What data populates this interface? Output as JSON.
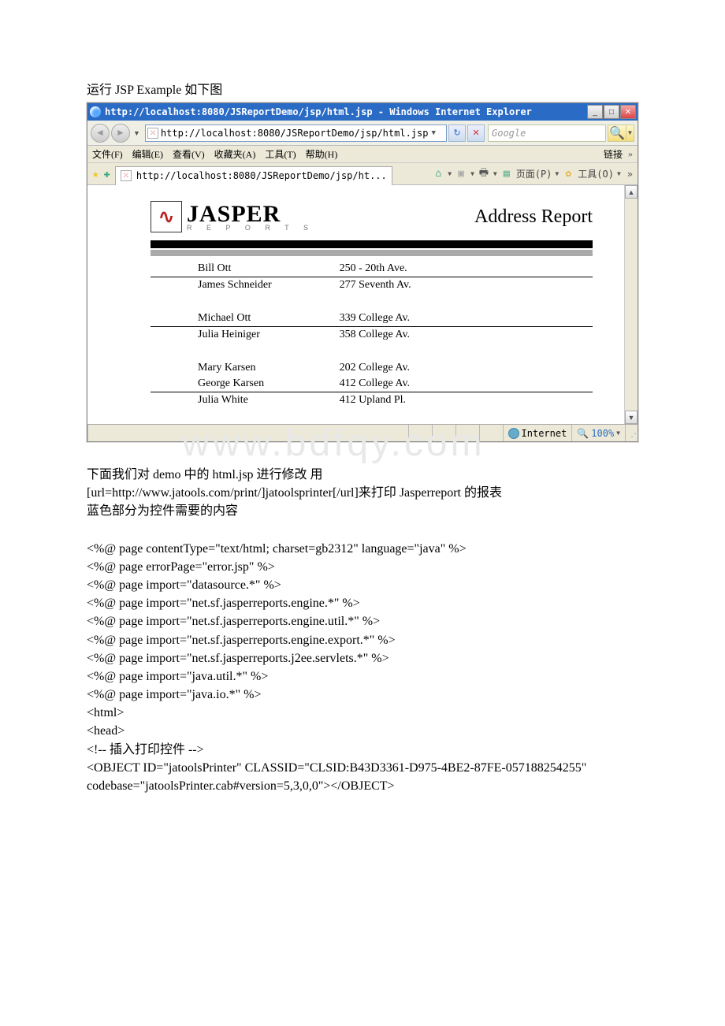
{
  "intro": "运行 JSP Example 如下图",
  "browser": {
    "title": "http://localhost:8080/JSReportDemo/jsp/html.jsp - Windows Internet Explorer",
    "address": "http://localhost:8080/JSReportDemo/jsp/html.jsp",
    "search_placeholder": "Google",
    "menus": {
      "file": "文件(F)",
      "edit": "编辑(E)",
      "view": "查看(V)",
      "fav": "收藏夹(A)",
      "tools": "工具(T)",
      "help": "帮助(H)",
      "links": "链接"
    },
    "tab_text": "http://localhost:8080/JSReportDemo/jsp/ht...",
    "tool_labels": {
      "page": "页面(P)",
      "tools": "工具(O)"
    },
    "status": {
      "zone": "Internet",
      "zoom": "100%"
    }
  },
  "report": {
    "logo_main": "JASPER",
    "logo_sub": "R E P O R T S",
    "title": "Address Report",
    "groups": [
      {
        "rows": [
          {
            "name": "Bill Ott",
            "addr": "250 - 20th Ave."
          },
          {
            "name": "James Schneider",
            "addr": "277 Seventh Av."
          }
        ]
      },
      {
        "rows": [
          {
            "name": "Michael Ott",
            "addr": "339 College Av."
          },
          {
            "name": "Julia Heiniger",
            "addr": "358 College Av."
          }
        ]
      },
      {
        "rows": [
          {
            "name": "Mary Karsen",
            "addr": "202 College Av."
          },
          {
            "name": "George Karsen",
            "addr": "412 College Av."
          },
          {
            "name": "Julia White",
            "addr": "412 Upland Pl."
          }
        ]
      }
    ],
    "watermark": "www.bdfqy.com"
  },
  "after": {
    "p1": "下面我们对 demo 中的 html.jsp 进行修改 用",
    "p2": "[url=http://www.jatools.com/print/]jatoolsprinter[/url]来打印 Jasperreport 的报表",
    "p3": "蓝色部分为控件需要的内容",
    "code": [
      "<%@ page contentType=\"text/html; charset=gb2312\" language=\"java\" %>",
      "<%@ page errorPage=\"error.jsp\" %>",
      "<%@ page import=\"datasource.*\" %>",
      "<%@ page import=\"net.sf.jasperreports.engine.*\" %>",
      "<%@ page import=\"net.sf.jasperreports.engine.util.*\" %>",
      "<%@ page import=\"net.sf.jasperreports.engine.export.*\" %>",
      "<%@ page import=\"net.sf.jasperreports.j2ee.servlets.*\" %>",
      "<%@ page import=\"java.util.*\" %>",
      "<%@ page import=\"java.io.*\" %>",
      "<html>",
      "<head>",
      "<!-- 插入打印控件 -->",
      "<OBJECT ID=\"jatoolsPrinter\" CLASSID=\"CLSID:B43D3361-D975-4BE2-87FE-057188254255\"",
      "codebase=\"jatoolsPrinter.cab#version=5,3,0,0\"></OBJECT>"
    ]
  }
}
